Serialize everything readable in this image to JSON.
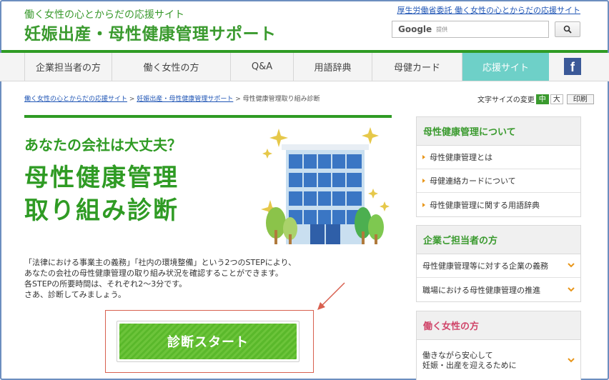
{
  "header": {
    "subtitle": "働く女性の心とからだの応援サイト",
    "title": "妊娠出産・母性健康管理サポート",
    "top_link": "厚生労働省委託 働く女性の心とからだの応援サイト",
    "search_brand": "Google",
    "search_provided": "提供"
  },
  "nav": {
    "items": [
      "企業担当者の方",
      "働く女性の方",
      "Q&A",
      "用語辞典",
      "母健カード",
      "応援サイト"
    ],
    "facebook": "f"
  },
  "breadcrumb": {
    "crumb1": "働く女性の心とからだの応援サイト",
    "crumb2": "妊娠出産・母性健康管理サポート",
    "current": "母性健康管理取り組み診断",
    "sep": ">"
  },
  "fontsize": {
    "label": "文字サイズの変更",
    "mid": "中",
    "large": "大",
    "print": "印刷"
  },
  "main": {
    "question": "あなたの会社は大丈夫？",
    "title_line1": "母性健康管理",
    "title_line2": "取り組み診断",
    "intro": [
      "「法律における事業主の義務」「社内の環境整備」という2つのSTEPにより、",
      "あなたの会社の母性健康管理の取り組み状況を確認することができます。",
      "各STEPの所要時間は、それぞれ2～3分です。",
      "さあ、診断してみましょう。"
    ],
    "start_button": "診断スタート"
  },
  "sidebar": {
    "box1": {
      "heading": "母性健康管理について",
      "items": [
        "母性健康管理とは",
        "母健連絡カードについて",
        "母性健康管理に関する用語辞典"
      ]
    },
    "box2": {
      "heading": "企業ご担当者の方",
      "items": [
        "母性健康管理等に対する企業の義務",
        "職場における母性健康管理の推進"
      ]
    },
    "box3": {
      "heading": "働く女性の方",
      "item_line1": "働きながら安心して",
      "item_line2": "妊娠・出産を迎えるために"
    }
  },
  "colors": {
    "brand_green": "#2f9b24",
    "nav_active": "#6ed0c8",
    "sidebar_pink": "#d0466a",
    "highlight_red": "#d8604f"
  }
}
